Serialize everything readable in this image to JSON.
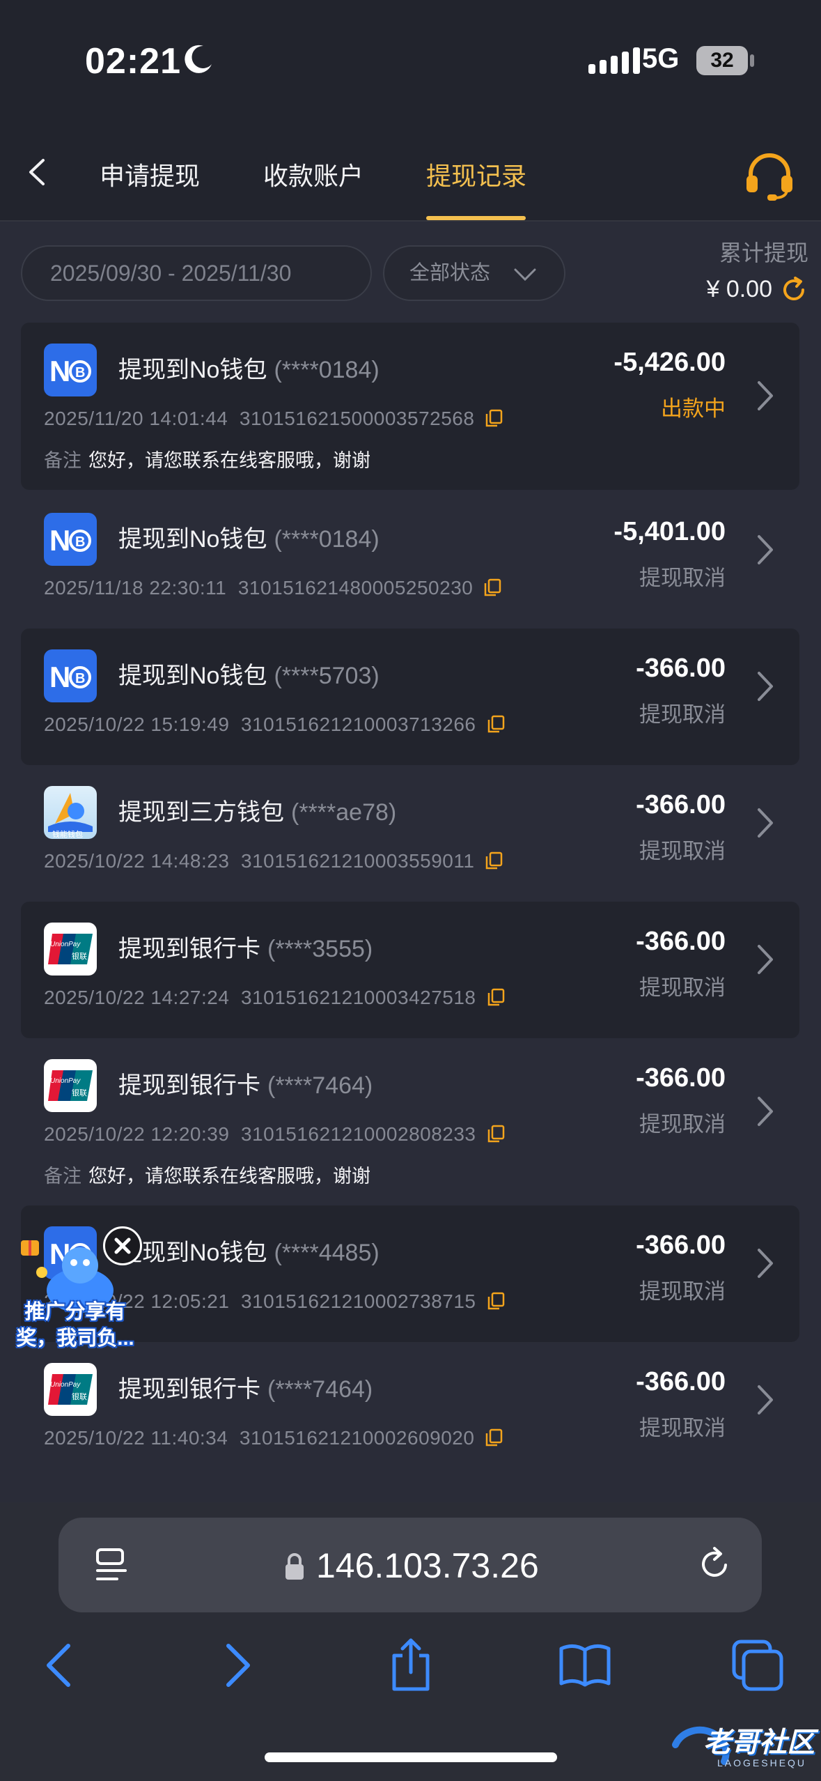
{
  "status_bar": {
    "time": "02:21",
    "network": "5G",
    "battery": "32"
  },
  "tabs": [
    {
      "label": "申请提现",
      "active": false
    },
    {
      "label": "收款账户",
      "active": false
    },
    {
      "label": "提现记录",
      "active": true
    }
  ],
  "filters": {
    "date_range": "2025/09/30 - 2025/11/30",
    "status": "全部状态",
    "total_label": "累计提现",
    "total_value": "¥ 0.00"
  },
  "records": [
    {
      "logo": "no-wallet",
      "title": "提现到No钱包",
      "account": "(****0184)",
      "datetime": "2025/11/20 14:01:44",
      "order_no": "310151621500003572568",
      "amount": "-5,426.00",
      "status": "出款中",
      "remark_label": "备注",
      "remark": "您好，请您联系在线客服哦，谢谢"
    },
    {
      "logo": "no-wallet",
      "title": "提现到No钱包",
      "account": "(****0184)",
      "datetime": "2025/11/18 22:30:11",
      "order_no": "310151621480005250230",
      "amount": "-5,401.00",
      "status": "提现取消"
    },
    {
      "logo": "no-wallet",
      "title": "提现到No钱包",
      "account": "(****5703)",
      "datetime": "2025/10/22 15:19:49",
      "order_no": "310151621210003713266",
      "amount": "-366.00",
      "status": "提现取消"
    },
    {
      "logo": "third-party-wallet",
      "title": "提现到三方钱包",
      "account": "(****ae78)",
      "datetime": "2025/10/22 14:48:23",
      "order_no": "310151621210003559011",
      "amount": "-366.00",
      "status": "提现取消"
    },
    {
      "logo": "unionpay",
      "title": "提现到银行卡",
      "account": "(****3555)",
      "datetime": "2025/10/22 14:27:24",
      "order_no": "310151621210003427518",
      "amount": "-366.00",
      "status": "提现取消"
    },
    {
      "logo": "unionpay",
      "title": "提现到银行卡",
      "account": "(****7464)",
      "datetime": "2025/10/22 12:20:39",
      "order_no": "310151621210002808233",
      "amount": "-366.00",
      "status": "提现取消",
      "remark_label": "备注",
      "remark": "您好，请您联系在线客服哦，谢谢"
    },
    {
      "logo": "no-wallet",
      "title": "提现到No钱包",
      "account": "(****4485)",
      "datetime": "2025/10/22 12:05:21",
      "order_no": "310151621210002738715",
      "amount": "-366.00",
      "status": "提现取消"
    },
    {
      "logo": "unionpay",
      "title": "提现到银行卡",
      "account": "(****7464)",
      "datetime": "2025/10/22 11:40:34",
      "order_no": "310151621210002609020",
      "amount": "-366.00",
      "status": "提现取消"
    }
  ],
  "logos": {
    "no_wallet": "N",
    "unionpay_top": "UnionPay",
    "unionpay_bottom": "银联",
    "third_party": "钱能钱包"
  },
  "promo": {
    "line1": "推广分享有",
    "line2": "奖，我司负..."
  },
  "browser": {
    "url": "146.103.73.26"
  },
  "watermark": {
    "text": "老哥社区",
    "sub": "LAOGESHEQU"
  },
  "colors": {
    "accent": "#f4c04f",
    "processing": "#f4a41c",
    "browser_blue": "#3d8bff",
    "no_wallet_blue": "#2d6de8"
  }
}
